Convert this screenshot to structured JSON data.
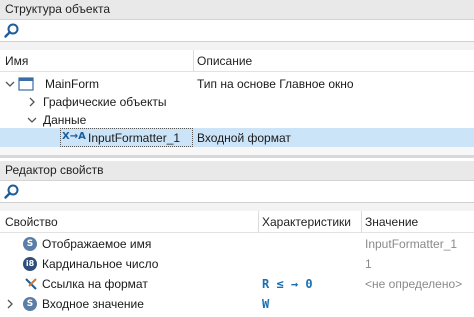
{
  "structure_panel": {
    "title": "Структура объекта",
    "search_placeholder": "",
    "columns": {
      "name": "Имя",
      "description": "Описание"
    },
    "tree": [
      {
        "label": "MainForm",
        "description": "Тип на основе Главное окно"
      },
      {
        "label": "Графические объекты",
        "description": ""
      },
      {
        "label": "Данные",
        "description": ""
      },
      {
        "label": "InputFormatter_1",
        "description": "Входной формат",
        "icon_text": "X→A"
      }
    ]
  },
  "property_panel": {
    "title": "Редактор свойств",
    "search_placeholder": "",
    "columns": {
      "property": "Свойство",
      "characteristics": "Характеристики",
      "value": "Значение"
    },
    "rows": [
      {
        "icon": "S",
        "label": "Отображаемое имя",
        "characteristics": "",
        "value": "InputFormatter_1"
      },
      {
        "icon": "i8",
        "label": "Кардинальное число",
        "characteristics": "",
        "value": "1"
      },
      {
        "icon": "link",
        "label": "Ссылка на формат",
        "characteristics": "R ≤ → 0",
        "value": "<не определено>"
      },
      {
        "icon": "S",
        "label": "Входное значение",
        "characteristics": "W",
        "value": ""
      }
    ]
  },
  "colors": {
    "selected_row": "#cce4f7",
    "header_bg": "#e9e9e9",
    "accent": "#1a6fb0"
  }
}
